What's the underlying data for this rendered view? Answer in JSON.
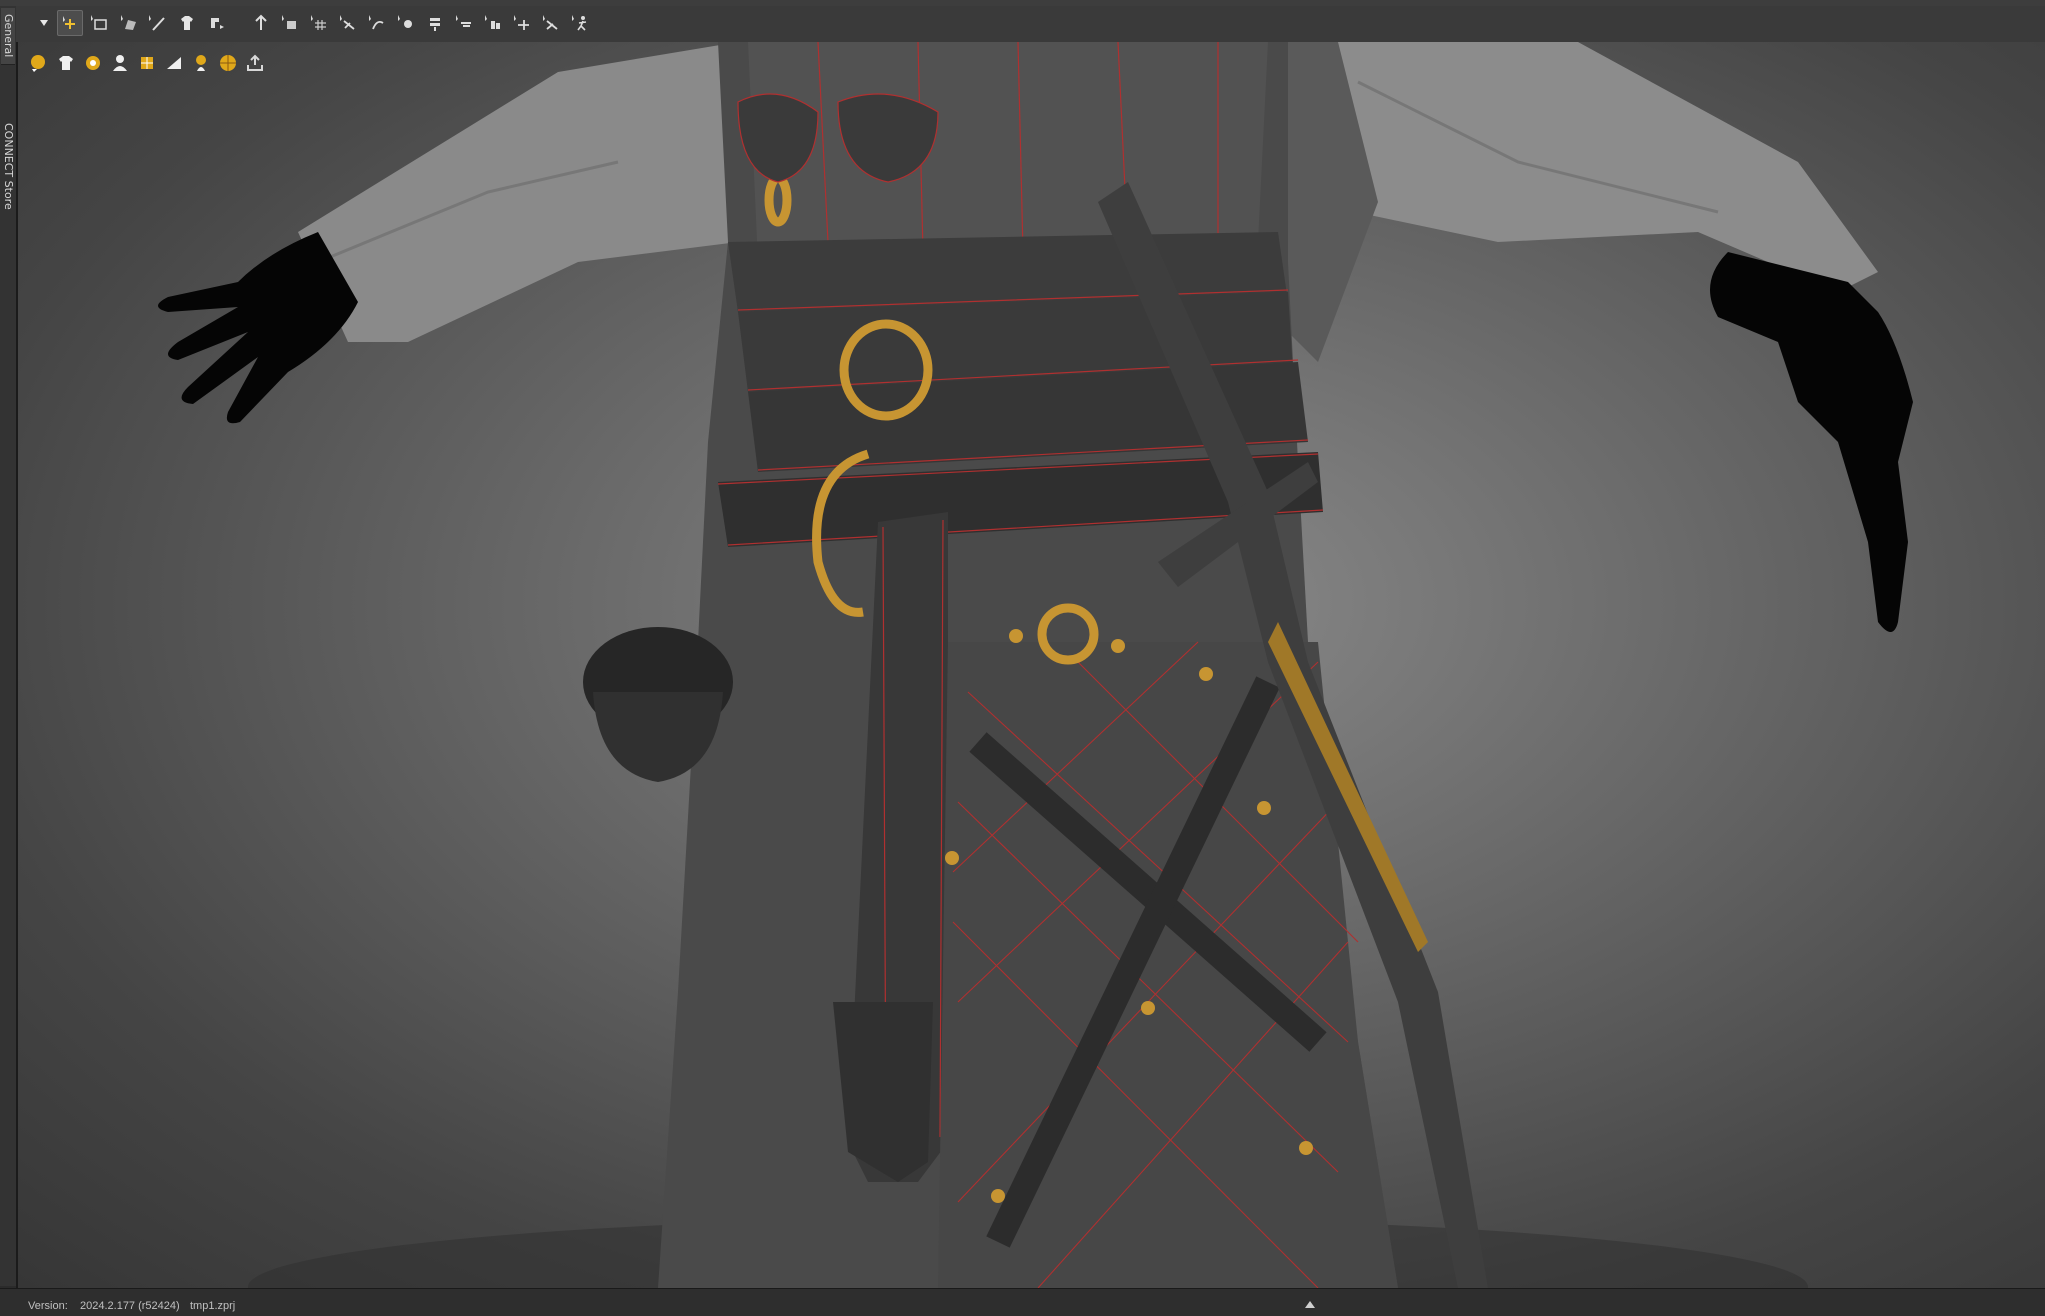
{
  "sidebar": {
    "tabs": [
      {
        "label": "General"
      },
      {
        "label": "CONNECT Store"
      }
    ]
  },
  "toolbar": {
    "tools": [
      {
        "icon": "select-arrow-icon"
      },
      {
        "icon": "transform-move-icon",
        "active": true
      },
      {
        "icon": "select-rectangle-icon"
      },
      {
        "icon": "select-mesh-icon"
      },
      {
        "icon": "edit-line-icon"
      },
      {
        "icon": "garment-pattern-icon"
      },
      {
        "icon": "pattern-transform-icon"
      },
      {
        "icon": "fold-arrangement-icon"
      },
      {
        "icon": "edit-pattern-icon"
      },
      {
        "icon": "grid-pattern-icon"
      },
      {
        "icon": "segment-sewing-icon"
      },
      {
        "icon": "free-sewing-icon"
      },
      {
        "icon": "pin-icon"
      },
      {
        "icon": "fabric-layer-icon"
      },
      {
        "icon": "tape-icon"
      },
      {
        "icon": "trim-icon"
      },
      {
        "icon": "measure-icon"
      },
      {
        "icon": "stitch-icon"
      },
      {
        "icon": "avatar-pose-icon"
      }
    ]
  },
  "viewport": {
    "icons": [
      {
        "icon": "show-garment-yellow-icon",
        "color": "#e0a81a"
      },
      {
        "icon": "shirt-icon",
        "color": "#f0f0f0"
      },
      {
        "icon": "garment-sync-icon",
        "color": "#e0a81a"
      },
      {
        "icon": "avatar-icon",
        "color": "#f0f0f0"
      },
      {
        "icon": "texture-icon",
        "color": "#e0a81a"
      },
      {
        "icon": "render-mode-icon",
        "color": "#f0f0f0"
      },
      {
        "icon": "lighting-icon",
        "color": "#e0a81a"
      },
      {
        "icon": "environment-sphere-icon",
        "color": "#e0a81a"
      },
      {
        "icon": "export-icon",
        "color": "#d8d8d8"
      }
    ]
  },
  "status": {
    "version_label": "Version:",
    "version_value": "2024.2.177 (r52424)",
    "project_file": "tmp1.zprj"
  }
}
